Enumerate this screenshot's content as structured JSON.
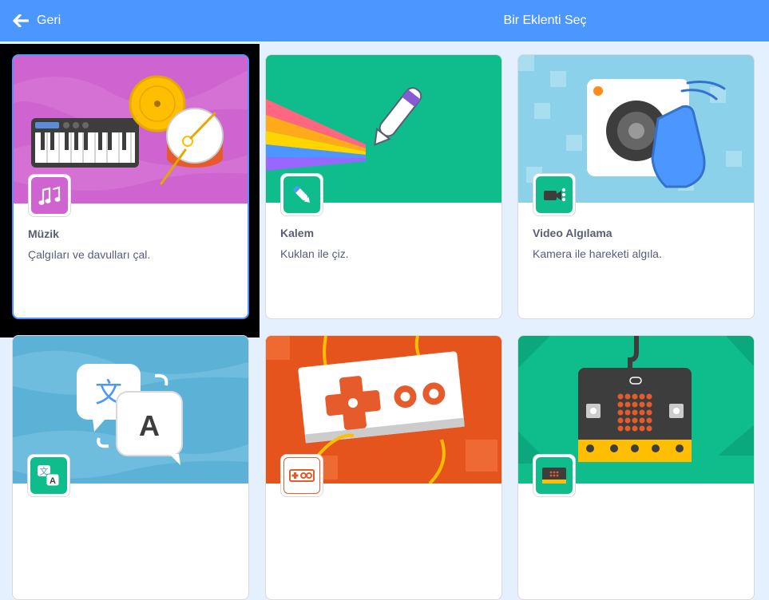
{
  "header": {
    "back_label": "Geri",
    "title": "Bir Eklenti Seç"
  },
  "extensions": [
    {
      "name": "Müzik",
      "description": "Çalgıları ve davulları çal.",
      "icon": "music-notes-icon",
      "color": "#cf63cf"
    },
    {
      "name": "Kalem",
      "description": "Kuklan ile çiz.",
      "icon": "pen-icon",
      "color": "#0fbd8c"
    },
    {
      "name": "Video Algılama",
      "description": "Kamera ile hareketi algıla.",
      "icon": "video-camera-icon",
      "color": "#0fbd8c"
    },
    {
      "name": "",
      "description": "",
      "icon": "translate-icon",
      "color": "#0fbd8c"
    },
    {
      "name": "",
      "description": "",
      "icon": "makey-makey-icon",
      "color": "#ffffff"
    },
    {
      "name": "",
      "description": "",
      "icon": "microbit-icon",
      "color": "#0fbd8c"
    }
  ],
  "art_text": {
    "translate_src": "文",
    "translate_dst": "A",
    "badge_src": "文",
    "badge_dst": "A"
  }
}
